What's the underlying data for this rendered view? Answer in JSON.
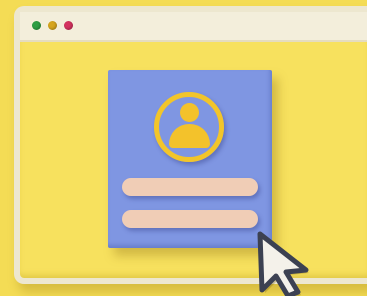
{
  "window": {
    "controls": [
      "close",
      "minimize",
      "maximize"
    ]
  },
  "profile_card": {
    "icon": "user-avatar-icon",
    "fields": [
      {
        "value": ""
      },
      {
        "value": ""
      }
    ]
  },
  "cursor": {
    "icon": "pointer-cursor-icon"
  },
  "colors": {
    "background": "#f4dc55",
    "frame": "#ede7cf",
    "card": "#7f96e2",
    "avatar": "#f3c22b",
    "field": "#f0cdb6",
    "dot_green": "#2e9e44",
    "dot_yellow": "#d6a51d",
    "dot_red": "#d4325f"
  }
}
